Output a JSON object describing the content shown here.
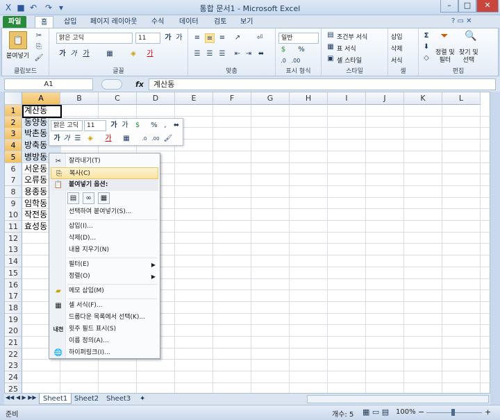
{
  "window": {
    "title": "통합 문서1 - Microsoft Excel"
  },
  "tabs": [
    "파일",
    "홈",
    "삽입",
    "페이지 레이아웃",
    "수식",
    "데이터",
    "검토",
    "보기"
  ],
  "ribbon": {
    "clipboard": {
      "paste": "붙여넣기",
      "label": "클립보드"
    },
    "font": {
      "name": "맑은 고딕",
      "size": "11",
      "label": "글꼴",
      "bold": "가",
      "italic": "가",
      "underline": "가",
      "fontcolor": "가",
      "grow": "가",
      "shrink": "가"
    },
    "align": {
      "label": "맞춤"
    },
    "number": {
      "format": "일반",
      "label": "표시 형식",
      "percent": "%"
    },
    "styles": {
      "cond": "조건부 서식",
      "table": "표 서식",
      "cell": "셀 스타일",
      "label": "스타일"
    },
    "cells": {
      "insert": "삽입",
      "delete": "삭제",
      "format": "서식",
      "label": "셀"
    },
    "editing": {
      "sort": "정렬 및\n필터",
      "find": "찾기 및\n선택",
      "label": "편집",
      "sigma": "Σ"
    }
  },
  "formula_bar": {
    "name_box": "A1",
    "fx": "fx",
    "value": "계산동"
  },
  "columns": [
    "A",
    "B",
    "C",
    "D",
    "E",
    "F",
    "G",
    "H",
    "I",
    "J",
    "K",
    "L"
  ],
  "rows": [
    "1",
    "2",
    "3",
    "4",
    "5",
    "6",
    "7",
    "8",
    "9",
    "10",
    "11",
    "12",
    "13",
    "14",
    "15",
    "16",
    "17",
    "18",
    "19",
    "20",
    "21",
    "22",
    "23",
    "24",
    "25"
  ],
  "cells_a": [
    "계산동",
    "동양동",
    "박촌동",
    "방축동",
    "병방동",
    "서운동",
    "오류동",
    "용종동",
    "임학동",
    "작전동",
    "효성동"
  ],
  "mini_toolbar": {
    "font": "맑은 고딕",
    "size": "11",
    "percent": "%",
    "comma": ","
  },
  "context_menu": {
    "cut": "잘라내기(T)",
    "copy": "복사(C)",
    "paste_options": "붙여넣기 옵션:",
    "paste_special": "선택하여 붙여넣기(S)...",
    "insert": "삽입(I)...",
    "delete": "삭제(D)...",
    "clear": "내용 지우기(N)",
    "filter": "필터(E)",
    "sort": "정렬(O)",
    "comment": "메모 삽입(M)",
    "format": "셀 서식(F)...",
    "dropdown": "드롭다운 목록에서 선택(K)...",
    "phonetic": "윗주 필드 표시(S)",
    "define": "이름 정의(A)...",
    "hyperlink": "하이퍼링크(I)..."
  },
  "sheets": [
    "Sheet1",
    "Sheet2",
    "Sheet3"
  ],
  "status": {
    "ready": "준비",
    "count": "개수: 5",
    "zoom": "100%",
    "minus": "−",
    "plus": "+"
  }
}
